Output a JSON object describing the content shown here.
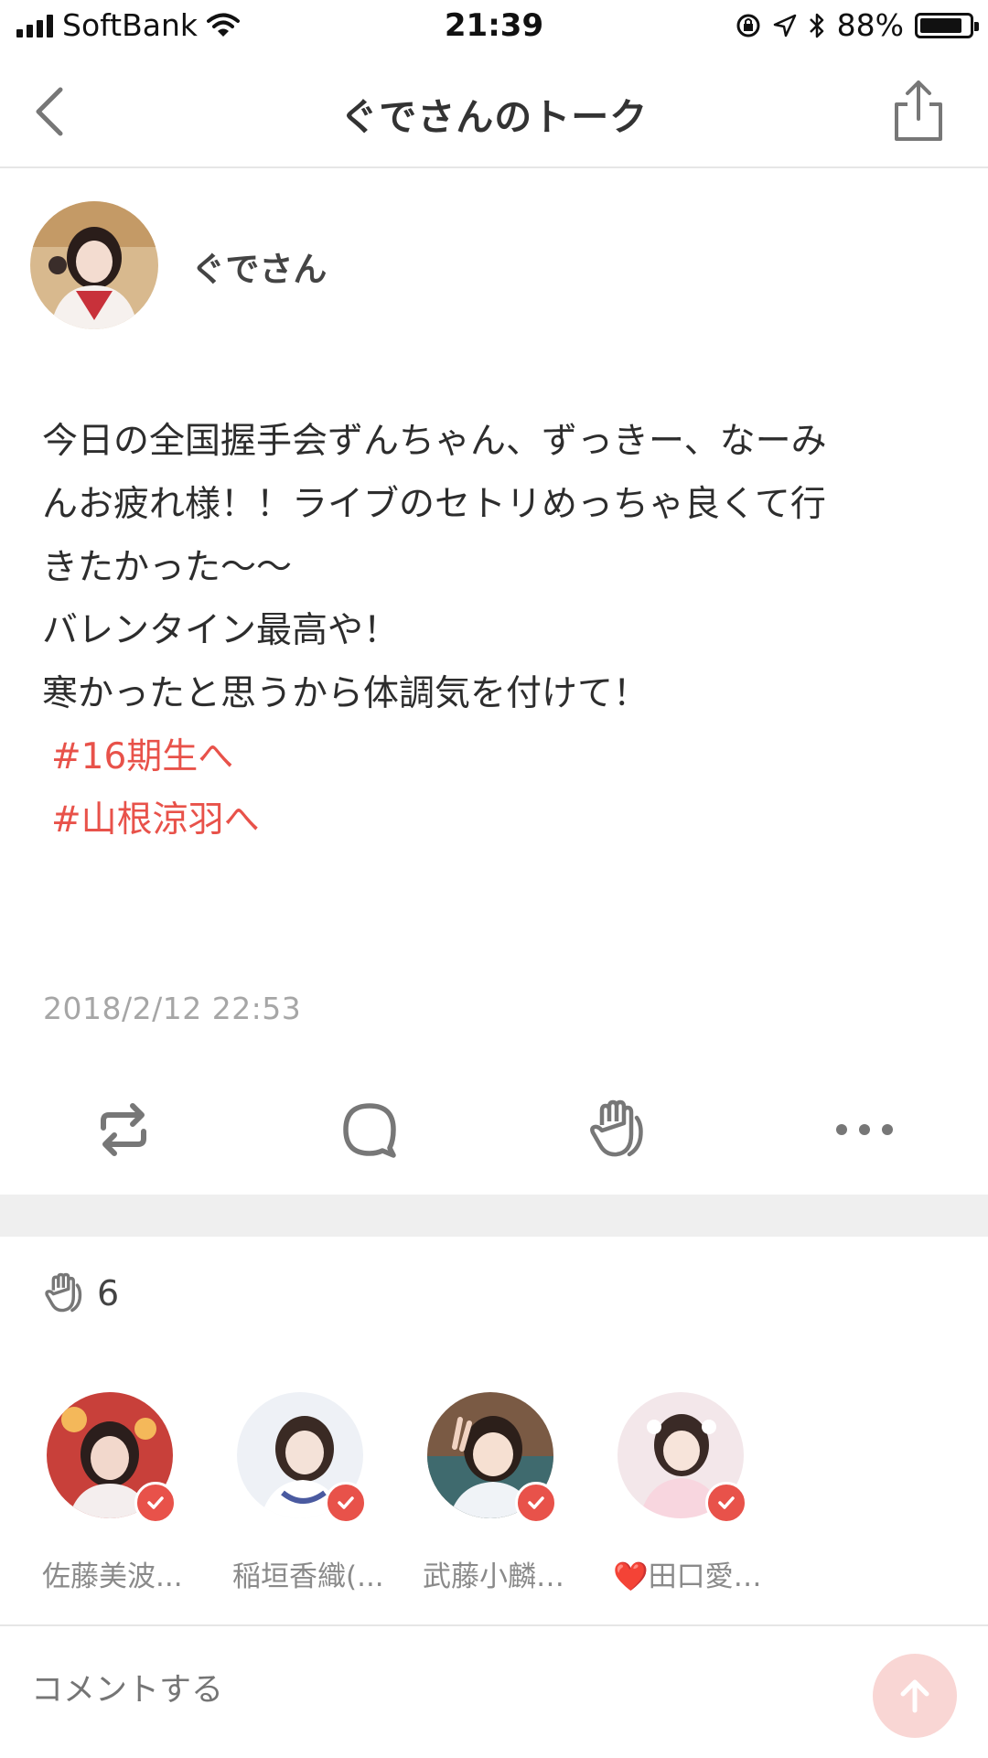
{
  "status_bar": {
    "carrier": "SoftBank",
    "time": "21:39",
    "battery_percent": "88%",
    "battery_level": 0.88,
    "icons": [
      "signal-icon",
      "wifi-icon",
      "orientation-lock-icon",
      "location-icon",
      "bluetooth-icon",
      "battery-icon"
    ]
  },
  "header": {
    "title": "ぐでさんのトーク",
    "back_icon": "chevron-left-icon",
    "share_icon": "share-icon"
  },
  "post": {
    "author": "ぐでさん",
    "lines": [
      "今日の全国握手会ずんちゃん、ずっきー、なーみ",
      "んお疲れ様！！ライブのセトリめっちゃ良くて行",
      "きたかった〜〜",
      "バレンタイン最高や！",
      "寒かったと思うから体調気を付けて！"
    ],
    "hashtags": [
      "#16期生へ",
      "#山根涼羽へ"
    ],
    "timestamp": "2018/2/12 22:53"
  },
  "actions": {
    "icons": [
      "repost-icon",
      "comment-icon",
      "clap-icon",
      "more-icon"
    ]
  },
  "reactions": {
    "clap_count": "6",
    "reactors": [
      {
        "name": "佐藤美波..."
      },
      {
        "name": "稲垣香織(..."
      },
      {
        "name": "武藤小麟…"
      },
      {
        "name": "❤️田口愛…"
      }
    ]
  },
  "comment": {
    "placeholder": "コメントする",
    "send_icon": "arrow-up-icon"
  },
  "colors": {
    "accent": "#e8524a",
    "send_bg": "#f9d6d4",
    "divider": "#efefef"
  }
}
